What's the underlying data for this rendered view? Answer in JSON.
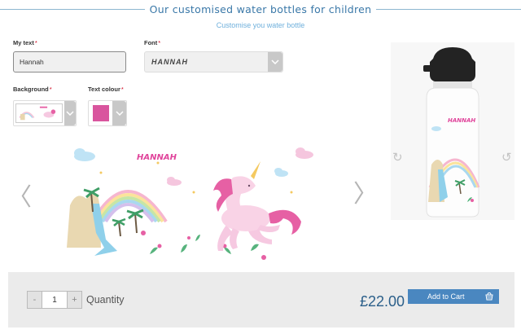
{
  "header": {
    "title": "Our customised water bottles for children",
    "subtitle": "Customise you water bottle"
  },
  "form": {
    "my_text_label": "My text",
    "my_text_value": "Hannah",
    "font_label": "Font",
    "font_value": "HANNAH",
    "background_label": "Background",
    "text_colour_label": "Text colour",
    "required_marker": "*",
    "text_colour_hex": "#d9559e"
  },
  "preview": {
    "art_text": "HANNAH",
    "bottle_text": "HANNAH",
    "prev_arrow": "〈",
    "next_arrow": "〉",
    "rotate_left": "↻",
    "rotate_right": "↺"
  },
  "purchase": {
    "quantity_minus": "-",
    "quantity_value": "1",
    "quantity_plus": "+",
    "quantity_label": "Quantity",
    "price": "£22.00",
    "add_to_cart_label": "Add to Cart"
  },
  "colors": {
    "accent_blue": "#4a87c0",
    "price_blue": "#2b5f8a",
    "title_blue": "#3a78a8",
    "pink": "#d9559e"
  }
}
